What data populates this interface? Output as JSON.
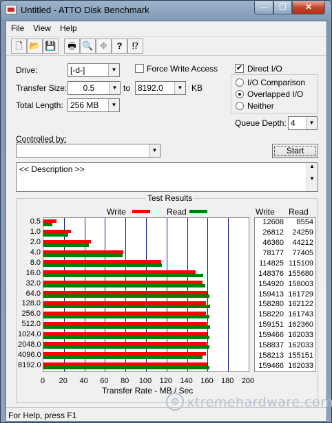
{
  "window": {
    "title": "Untitled - ATTO Disk Benchmark",
    "minimize": "—",
    "maximize": "☐",
    "close": "✕"
  },
  "menu": [
    "File",
    "View",
    "Help"
  ],
  "toolbar": [
    {
      "icon": "new-file-icon",
      "glyph": "🗋"
    },
    {
      "icon": "open-folder-icon",
      "glyph": "📂"
    },
    {
      "icon": "save-icon",
      "glyph": "💾"
    },
    {
      "icon": "print-icon",
      "glyph": "🖶"
    },
    {
      "icon": "print-preview-icon",
      "glyph": "🔍"
    },
    {
      "icon": "move-icon",
      "glyph": "✥"
    },
    {
      "icon": "help-icon",
      "glyph": "?"
    },
    {
      "icon": "context-help-icon",
      "glyph": "⁉"
    }
  ],
  "settings": {
    "drive_label": "Drive:",
    "drive_value": "[-d-]",
    "transfer_label": "Transfer Size:",
    "transfer_from": "0.5",
    "to_label": "to",
    "transfer_to": "8192.0",
    "unit": "KB",
    "length_label": "Total Length:",
    "length_value": "256 MB",
    "force_write_label": "Force Write Access",
    "force_write_checked": false,
    "direct_io_label": "Direct I/O",
    "direct_io_checked": true,
    "io_comparison_label": "I/O Comparison",
    "overlapped_label": "Overlapped I/O",
    "neither_label": "Neither",
    "selected_mode": "Overlapped I/O",
    "queue_label": "Queue Depth:",
    "queue_value": "4",
    "controlled_label": "Controlled by:",
    "controlled_value": "",
    "start_label": "Start",
    "description": "<< Description >>"
  },
  "results": {
    "title": "Test Results",
    "legend_write": "Write",
    "legend_read": "Read",
    "col_write": "Write",
    "col_read": "Read",
    "xlabel": "Transfer Rate - MB / Sec"
  },
  "chart_data": {
    "type": "bar",
    "title": "Test Results",
    "xlabel": "Transfer Rate - MB / Sec",
    "xlim": [
      0,
      200
    ],
    "xticks": [
      "0",
      "20",
      "40",
      "60",
      "80",
      "100",
      "120",
      "140",
      "160",
      "180",
      "200"
    ],
    "categories": [
      "0.5",
      "1.0",
      "2.0",
      "4.0",
      "8.0",
      "16.0",
      "32.0",
      "64.0",
      "128.0",
      "256.0",
      "512.0",
      "1024.0",
      "2048.0",
      "4096.0",
      "8192.0"
    ],
    "series": [
      {
        "name": "Write",
        "color": "#ff0000",
        "values": [
          12608,
          26812,
          46360,
          78177,
          114825,
          148376,
          154920,
          159413,
          158280,
          158220,
          159151,
          159466,
          158837,
          158213,
          159466
        ]
      },
      {
        "name": "Read",
        "color": "#008000",
        "values": [
          8554,
          24259,
          44212,
          77405,
          115109,
          155680,
          158003,
          161729,
          162122,
          161743,
          162360,
          162033,
          162033,
          155151,
          162033
        ]
      }
    ]
  },
  "status": "For Help, press F1",
  "watermark": "xtremehardware.com",
  "watermark_glyph": "⚙"
}
